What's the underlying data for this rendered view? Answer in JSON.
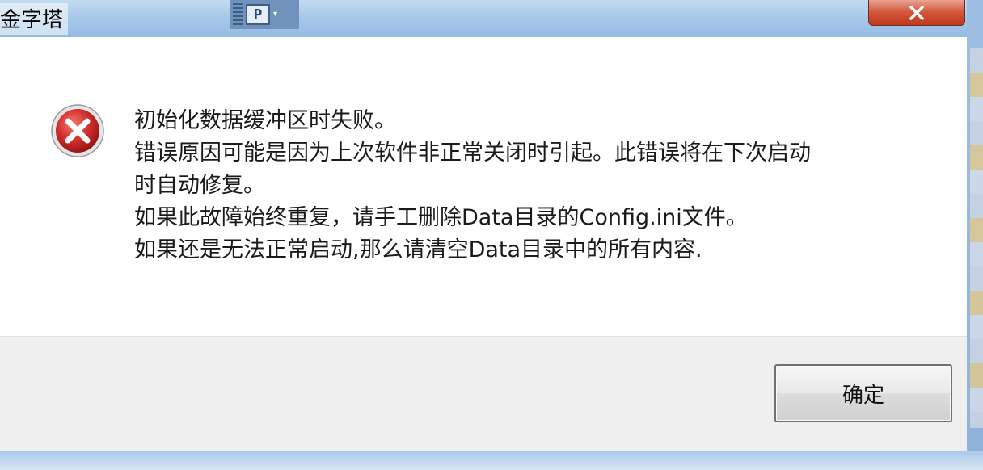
{
  "window": {
    "title": "金字塔",
    "close_icon": "close-icon"
  },
  "toolbar_widget": {
    "label": "P"
  },
  "dialog": {
    "icon": "error-icon",
    "message_lines": [
      "初始化数据缓冲区时失败。",
      "错误原因可能是因为上次软件非正常关闭时引起。此错误将在下次启动",
      "时自动修复。",
      "如果此故障始终重复，请手工删除Data目录的Config.ini文件。",
      "如果还是无法正常启动,那么请清空Data目录中的所有内容."
    ],
    "ok_label": "确定"
  },
  "colors": {
    "error_red": "#d32f2f",
    "close_red": "#c0391e"
  }
}
